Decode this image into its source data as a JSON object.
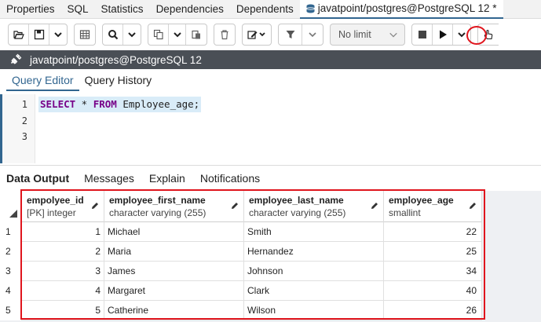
{
  "top_tabs": [
    "Properties",
    "SQL",
    "Statistics",
    "Dependencies",
    "Dependents"
  ],
  "active_tab": "javatpoint/postgres@PostgreSQL 12 *",
  "toolbar": {
    "limit_label": "No limit"
  },
  "connection": {
    "label": "javatpoint/postgres@PostgreSQL 12"
  },
  "query_tabs": [
    "Query Editor",
    "Query History"
  ],
  "editor": {
    "line_numbers": [
      "1",
      "2",
      "3"
    ],
    "kw_select": "SELECT",
    "star": " * ",
    "kw_from": "FROM",
    "rest": " Employee_age;"
  },
  "result_tabs": [
    "Data Output",
    "Messages",
    "Explain",
    "Notifications"
  ],
  "columns": [
    {
      "name": "empolyee_id",
      "type": "[PK] integer"
    },
    {
      "name": "employee_first_name",
      "type": "character varying (255)"
    },
    {
      "name": "employee_last_name",
      "type": "character varying (255)"
    },
    {
      "name": "employee_age",
      "type": "smallint"
    }
  ],
  "rows": [
    {
      "n": "1",
      "id": "1",
      "first": "Michael",
      "last": "Smith",
      "age": "22"
    },
    {
      "n": "2",
      "id": "2",
      "first": "Maria",
      "last": "Hernandez",
      "age": "25"
    },
    {
      "n": "3",
      "id": "3",
      "first": "James",
      "last": "Johnson",
      "age": "34"
    },
    {
      "n": "4",
      "id": "4",
      "first": "Margaret",
      "last": "Clark",
      "age": "40"
    },
    {
      "n": "5",
      "id": "5",
      "first": "Catherine",
      "last": "Wilson",
      "age": "26"
    }
  ]
}
